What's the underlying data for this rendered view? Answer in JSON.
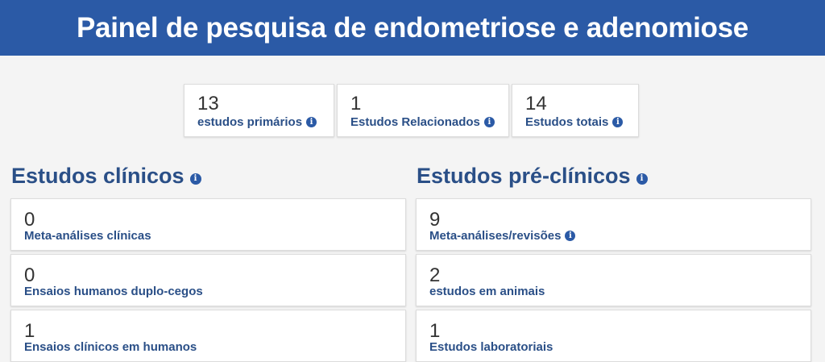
{
  "header": {
    "title": "Painel de pesquisa de endometriose e adenomiose"
  },
  "summary": [
    {
      "value": "13",
      "label": "estudos primários"
    },
    {
      "value": "1",
      "label": "Estudos Relacionados"
    },
    {
      "value": "14",
      "label": "Estudos totais"
    }
  ],
  "clinical": {
    "title": "Estudos clínicos",
    "items": [
      {
        "value": "0",
        "label": "Meta-análises clínicas"
      },
      {
        "value": "0",
        "label": "Ensaios humanos duplo-cegos"
      },
      {
        "value": "1",
        "label": "Ensaios clínicos em humanos"
      }
    ]
  },
  "preclinical": {
    "title": "Estudos pré-clínicos",
    "items": [
      {
        "value": "9",
        "label": "Meta-análises/revisões"
      },
      {
        "value": "2",
        "label": "estudos em animais"
      },
      {
        "value": "1",
        "label": "Estudos laboratoriais"
      }
    ]
  },
  "icons": {
    "info": "info-icon"
  },
  "colors": {
    "header_bg": "#2b5aa6",
    "label_text": "#2a4f87",
    "page_bg": "#f4f4f4"
  }
}
